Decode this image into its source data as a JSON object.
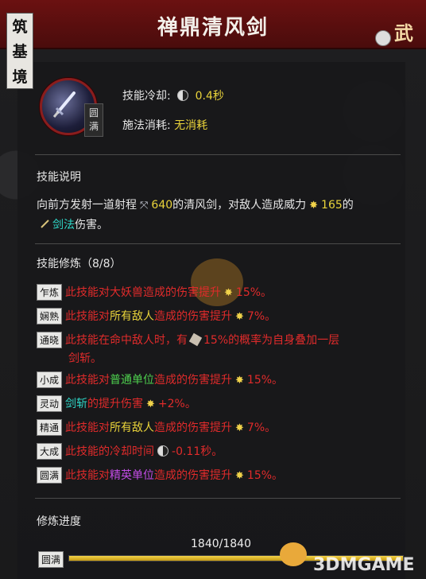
{
  "header": {
    "title": "禅鼎清风剑"
  },
  "realm": {
    "chars": [
      "筑",
      "基",
      "境"
    ]
  },
  "corner": {
    "glyph": "武"
  },
  "skill": {
    "rank_chars": [
      "圆",
      "满"
    ],
    "cooldown_label": "技能冷却:",
    "cooldown_value": "0.4秒",
    "cost_label": "施法消耗:",
    "cost_value": "无消耗"
  },
  "description": {
    "heading": "技能说明",
    "line1_a": "向前方发射一道射程",
    "range_value": "640",
    "line1_b": "的清风剑，对敌人造成威力",
    "power_value": "165",
    "line1_c": "的",
    "line2_type": "剑法",
    "line2_b": "伤害。"
  },
  "cultivation": {
    "heading": "技能修炼（8/8）",
    "traits": [
      {
        "tag": "乍炼",
        "a": "此技能对大妖兽造成的伤害提升",
        "b": "15%。"
      },
      {
        "tag": "娴熟",
        "a": "此技能对",
        "hl": "所有敌人",
        "c": "造成的伤害提升",
        "b": "7%。"
      },
      {
        "tag": "通晓",
        "a": "此技能在命中敌人时，有",
        "b": "15%的概率为自身叠加一层",
        "line2": "剑斩。"
      },
      {
        "tag": "小成",
        "a": "此技能对",
        "hl": "普通单位",
        "c": "造成的伤害提升",
        "b": "15%。"
      },
      {
        "tag": "灵动",
        "hl": "剑斩",
        "a": "的提升伤害",
        "b": "+2%。"
      },
      {
        "tag": "精通",
        "a": "此技能对",
        "hl": "所有敌人",
        "c": "造成的伤害提升",
        "b": "7%。"
      },
      {
        "tag": "大成",
        "a": "此技能的冷却时间",
        "b": "-0.11秒。"
      },
      {
        "tag": "圆满",
        "a": "此技能对",
        "hl": "精英单位",
        "c": "造成的伤害提升",
        "b": "15%。"
      }
    ]
  },
  "progress": {
    "heading": "修炼进度",
    "tag": "圆满",
    "text": "1840/1840",
    "fraction": 1.0
  },
  "watermark": "3DMGAME",
  "colors": {
    "banner": "#6b1111",
    "accent_yellow": "#e9d33a",
    "cyan": "#2fd7c8",
    "red": "#e02b2b",
    "green": "#4ed04e",
    "purple": "#c44ce6"
  }
}
